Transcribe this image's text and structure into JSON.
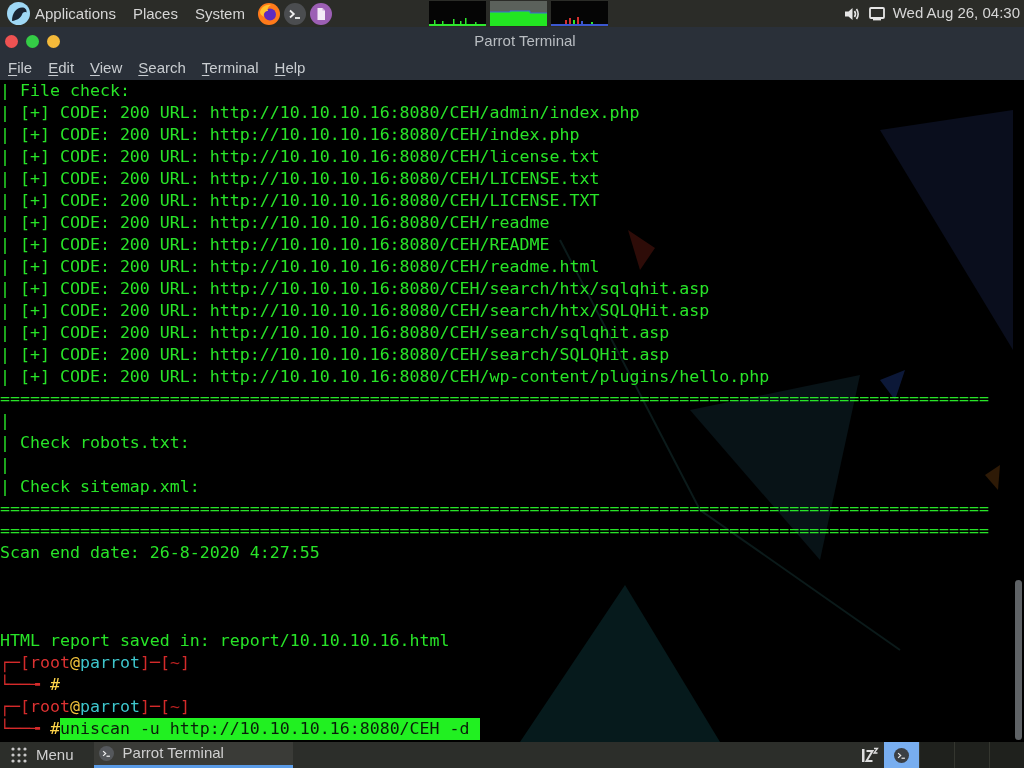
{
  "top_panel": {
    "menus": [
      "Applications",
      "Places",
      "System"
    ],
    "clock": "Wed Aug 26, 04:30"
  },
  "window": {
    "title": "Parrot Terminal",
    "menu": [
      "File",
      "Edit",
      "View",
      "Search",
      "Terminal",
      "Help"
    ]
  },
  "terminal": {
    "lines": [
      {
        "kind": "output",
        "text": "| File check:"
      },
      {
        "kind": "output",
        "text": "| [+] CODE: 200 URL: http://10.10.10.16:8080/CEH/admin/index.php"
      },
      {
        "kind": "output",
        "text": "| [+] CODE: 200 URL: http://10.10.10.16:8080/CEH/index.php"
      },
      {
        "kind": "output",
        "text": "| [+] CODE: 200 URL: http://10.10.10.16:8080/CEH/license.txt"
      },
      {
        "kind": "output",
        "text": "| [+] CODE: 200 URL: http://10.10.10.16:8080/CEH/LICENSE.txt"
      },
      {
        "kind": "output",
        "text": "| [+] CODE: 200 URL: http://10.10.10.16:8080/CEH/LICENSE.TXT"
      },
      {
        "kind": "output",
        "text": "| [+] CODE: 200 URL: http://10.10.10.16:8080/CEH/readme"
      },
      {
        "kind": "output",
        "text": "| [+] CODE: 200 URL: http://10.10.10.16:8080/CEH/README"
      },
      {
        "kind": "output",
        "text": "| [+] CODE: 200 URL: http://10.10.10.16:8080/CEH/readme.html"
      },
      {
        "kind": "output",
        "text": "| [+] CODE: 200 URL: http://10.10.10.16:8080/CEH/search/htx/sqlqhit.asp"
      },
      {
        "kind": "output",
        "text": "| [+] CODE: 200 URL: http://10.10.10.16:8080/CEH/search/htx/SQLQHit.asp"
      },
      {
        "kind": "output",
        "text": "| [+] CODE: 200 URL: http://10.10.10.16:8080/CEH/search/sqlqhit.asp"
      },
      {
        "kind": "output",
        "text": "| [+] CODE: 200 URL: http://10.10.10.16:8080/CEH/search/SQLQHit.asp"
      },
      {
        "kind": "output",
        "text": "| [+] CODE: 200 URL: http://10.10.10.16:8080/CEH/wp-content/plugins/hello.php"
      },
      {
        "kind": "output",
        "text": "==================================================================================================="
      },
      {
        "kind": "output",
        "text": "|"
      },
      {
        "kind": "output",
        "text": "| Check robots.txt:"
      },
      {
        "kind": "output",
        "text": "|"
      },
      {
        "kind": "output",
        "text": "| Check sitemap.xml:"
      },
      {
        "kind": "output",
        "text": "==================================================================================================="
      },
      {
        "kind": "output",
        "text": "==================================================================================================="
      },
      {
        "kind": "output",
        "text": "Scan end date: 26-8-2020 4:27:55"
      },
      {
        "kind": "blank"
      },
      {
        "kind": "blank"
      },
      {
        "kind": "blank"
      },
      {
        "kind": "output",
        "text": "HTML report saved in: report/10.10.10.16.html"
      },
      {
        "kind": "prompt",
        "segments": [
          {
            "kind": "frame",
            "text": "┌─["
          },
          {
            "kind": "user",
            "text": "root"
          },
          {
            "kind": "at",
            "text": "@"
          },
          {
            "kind": "host",
            "text": "parrot"
          },
          {
            "kind": "frame",
            "text": "]─["
          },
          {
            "kind": "dir",
            "text": "~"
          },
          {
            "kind": "frame",
            "text": "]"
          }
        ]
      },
      {
        "kind": "prompt",
        "segments": [
          {
            "kind": "frame",
            "text": "└──╼"
          },
          {
            "kind": "hash",
            "text": "#"
          }
        ]
      },
      {
        "kind": "prompt",
        "segments": [
          {
            "kind": "frame",
            "text": "┌─["
          },
          {
            "kind": "user",
            "text": "root"
          },
          {
            "kind": "at",
            "text": "@"
          },
          {
            "kind": "host",
            "text": "parrot"
          },
          {
            "kind": "frame",
            "text": "]─["
          },
          {
            "kind": "dir",
            "text": "~"
          },
          {
            "kind": "frame",
            "text": "]"
          }
        ]
      },
      {
        "kind": "prompt",
        "segments": [
          {
            "kind": "frame",
            "text": "└──╼"
          },
          {
            "kind": "hash",
            "text": "#"
          }
        ],
        "command": {
          "text": "uniscan -u http://10.10.10.16:8080/CEH -d",
          "selected": true
        }
      }
    ]
  },
  "taskbar": {
    "menu_label": "Menu",
    "tasks": [
      {
        "label": "Parrot Terminal",
        "selected": true
      }
    ],
    "workspaces": [
      {
        "selected": true,
        "has_window": true
      },
      {
        "selected": false,
        "has_window": false
      },
      {
        "selected": false,
        "has_window": false
      },
      {
        "selected": false,
        "has_window": false
      }
    ]
  }
}
